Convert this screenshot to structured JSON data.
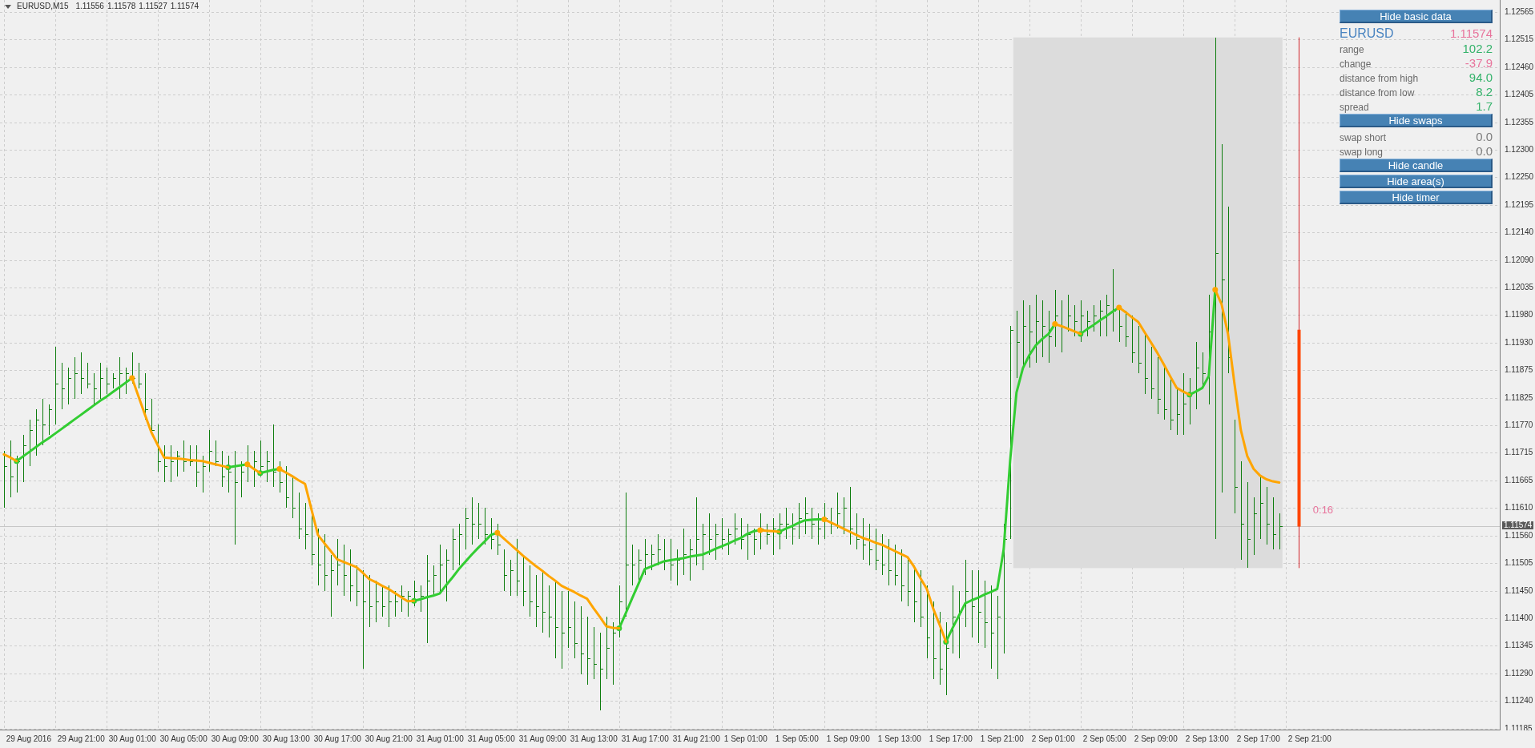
{
  "header": {
    "symbol": "EURUSD,M15",
    "quotes": [
      "1.11556",
      "1.11578",
      "1.11527",
      "1.11574"
    ]
  },
  "panel": [
    {
      "kind": "button",
      "label": "Hide basic data"
    },
    {
      "kind": "title",
      "label": "EURUSD",
      "value": "1.11574",
      "color": "#e8749c"
    },
    {
      "kind": "row",
      "label": "range",
      "value": "102.2",
      "color": "#35b36b"
    },
    {
      "kind": "row",
      "label": "change",
      "value": "-37.9",
      "color": "#e8749c"
    },
    {
      "kind": "row",
      "label": "distance from high",
      "value": "94.0",
      "color": "#35b36b"
    },
    {
      "kind": "row",
      "label": "distance from low",
      "value": "8.2",
      "color": "#35b36b"
    },
    {
      "kind": "row",
      "label": "spread",
      "value": "1.7",
      "color": "#35b36b"
    },
    {
      "kind": "button",
      "label": "Hide swaps"
    },
    {
      "kind": "row",
      "label": "swap short",
      "value": "0.0",
      "color": "#7d7d7d"
    },
    {
      "kind": "row",
      "label": "swap long",
      "value": "0.0",
      "color": "#7d7d7d"
    },
    {
      "kind": "button",
      "label": "Hide candle"
    },
    {
      "kind": "button",
      "label": "Hide area(s)"
    },
    {
      "kind": "button",
      "label": "Hide timer"
    }
  ],
  "chart": {
    "price_labels": [
      "1.12565",
      "1.12515",
      "1.12460",
      "1.12405",
      "1.12355",
      "1.12300",
      "1.12250",
      "1.12195",
      "1.12140",
      "1.12090",
      "1.12035",
      "1.11980",
      "1.11930",
      "1.11875",
      "1.11825",
      "1.11770",
      "1.11715",
      "1.11665",
      "1.11610",
      "1.11560",
      "1.11505",
      "1.11450",
      "1.11400",
      "1.11345",
      "1.11290",
      "1.11240",
      "1.11185"
    ],
    "time_labels": [
      "29 Aug 2016",
      "29 Aug 21:00",
      "30 Aug 01:00",
      "30 Aug 05:00",
      "30 Aug 09:00",
      "30 Aug 13:00",
      "30 Aug 17:00",
      "30 Aug 21:00",
      "31 Aug 01:00",
      "31 Aug 05:00",
      "31 Aug 09:00",
      "31 Aug 13:00",
      "31 Aug 17:00",
      "31 Aug 21:00",
      "1 Sep 01:00",
      "1 Sep 05:00",
      "1 Sep 09:00",
      "1 Sep 13:00",
      "1 Sep 17:00",
      "1 Sep 21:00",
      "2 Sep 01:00",
      "2 Sep 05:00",
      "2 Sep 09:00",
      "2 Sep 13:00",
      "2 Sep 17:00",
      "2 Sep 21:00"
    ],
    "current_price": "1.11574",
    "timer": "0:16"
  }
}
